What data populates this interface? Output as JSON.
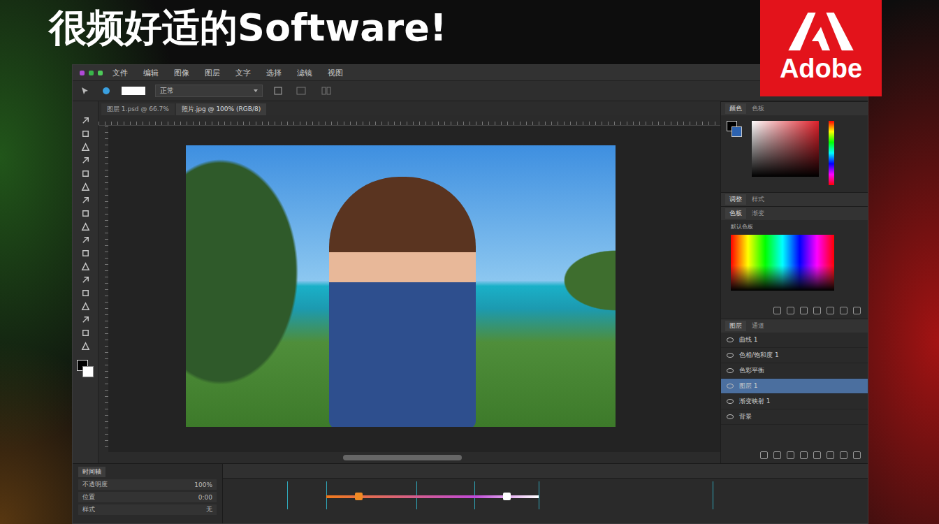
{
  "headline": "很频好适的Software!",
  "logo": {
    "text": "Adobe"
  },
  "menu": [
    "文件",
    "编辑",
    "图像",
    "图层",
    "文字",
    "选择",
    "滤镜",
    "视图"
  ],
  "options_bar": {
    "field": "正常"
  },
  "document_tabs": [
    {
      "label": "图层 1.psd @ 66.7%",
      "selected": false
    },
    {
      "label": "照片.jpg @ 100% (RGB/8)",
      "selected": true
    }
  ],
  "color_panel": {
    "tabs": [
      {
        "label": "颜色",
        "selected": true
      },
      {
        "label": "色板",
        "selected": false
      }
    ]
  },
  "adjust_panel": {
    "tabs": [
      {
        "label": "调整",
        "selected": true
      },
      {
        "label": "样式",
        "selected": false
      }
    ]
  },
  "swatch_panel": {
    "tabs": [
      {
        "label": "色板",
        "selected": true
      },
      {
        "label": "渐变",
        "selected": false
      }
    ],
    "caption": "默认色板"
  },
  "layers_panel": {
    "tabs": [
      {
        "label": "图层",
        "selected": true
      },
      {
        "label": "通道",
        "selected": false
      }
    ],
    "items": [
      {
        "name": "曲线 1",
        "selected": false
      },
      {
        "name": "色相/饱和度 1",
        "selected": false
      },
      {
        "name": "色彩平衡",
        "selected": false
      },
      {
        "name": "图层 1",
        "selected": true
      },
      {
        "name": "渐变映射 1",
        "selected": false
      },
      {
        "name": "背景",
        "selected": false
      }
    ]
  },
  "timeline": {
    "tabs": [
      {
        "label": "时间轴",
        "selected": true
      }
    ],
    "rows": [
      {
        "label": "不透明度",
        "value": "100%"
      },
      {
        "label": "位置",
        "value": "0:00"
      },
      {
        "label": "样式",
        "value": "无"
      }
    ],
    "range": {
      "start": 0.16,
      "end": 0.49
    },
    "handles": [
      {
        "level": 0.21,
        "color": "#f08a24"
      },
      {
        "level": 0.44,
        "color": "#ffffff"
      }
    ],
    "keyframes": [
      0.1,
      0.16,
      0.3,
      0.39,
      0.49,
      0.76
    ]
  }
}
